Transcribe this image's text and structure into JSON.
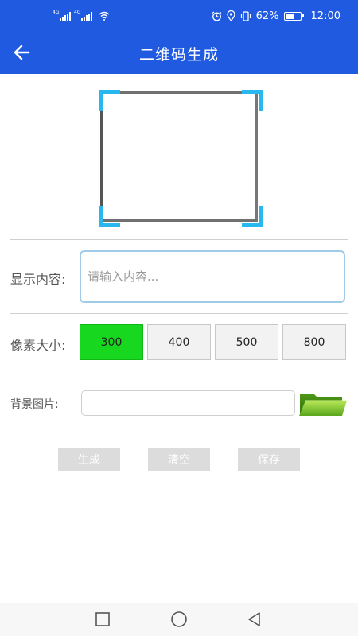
{
  "status_bar": {
    "network_tag_1": "4G",
    "network_tag_2": "4G",
    "battery_percent": "62%",
    "battery_level": 0.62,
    "time": "12:00",
    "icons": [
      "signal-icon",
      "signal-icon",
      "wifi-icon",
      "alarm-icon",
      "location-icon",
      "vibrate-icon",
      "battery-icon"
    ]
  },
  "app_bar": {
    "title": "二维码生成",
    "back_icon": "arrow-left-icon"
  },
  "content_field": {
    "label": "显示内容:",
    "placeholder": "请输入内容...",
    "value": ""
  },
  "pixel_size": {
    "label": "像素大小:",
    "options": [
      "300",
      "400",
      "500",
      "800"
    ],
    "selected": "300"
  },
  "background": {
    "label": "背景图片:",
    "value": "",
    "folder_icon": "folder-open-icon"
  },
  "actions": {
    "generate": "生成",
    "clear": "清空",
    "save": "保存"
  },
  "nav_bar": {
    "icons": [
      "square-recent-icon",
      "circle-home-icon",
      "triangle-back-icon"
    ]
  },
  "colors": {
    "primary": "#1f5ae0",
    "selected_size": "#17d81e",
    "scanner_corner": "#28b8ee",
    "action_button": "#dcdcdc"
  }
}
